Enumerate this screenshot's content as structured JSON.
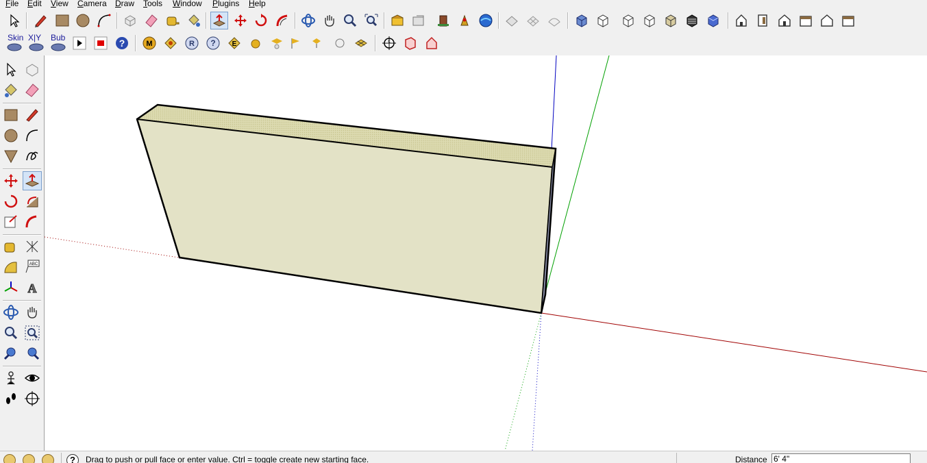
{
  "menu": [
    {
      "label": "File",
      "accel": "F"
    },
    {
      "label": "Edit",
      "accel": "E"
    },
    {
      "label": "View",
      "accel": "V"
    },
    {
      "label": "Camera",
      "accel": "C"
    },
    {
      "label": "Draw",
      "accel": "D"
    },
    {
      "label": "Tools",
      "accel": "T"
    },
    {
      "label": "Window",
      "accel": "W"
    },
    {
      "label": "Plugins",
      "accel": "P"
    },
    {
      "label": "Help",
      "accel": "H"
    }
  ],
  "plugins_toolbar": {
    "skin_label": "Skin",
    "xy_label": "X|Y",
    "bub_label": "Bub"
  },
  "status": {
    "message": "Drag to push or pull face or enter value.  Ctrl = toggle create new starting face.",
    "measurement_label": "Distance",
    "measurement_value": "6' 4\""
  },
  "colors": {
    "face": "#e3e2c6",
    "face_top": "#d7d5a8",
    "side": "#8a8ea8",
    "edge": "#000000",
    "axis_red": "#a00000",
    "axis_green": "#00a000",
    "axis_blue": "#0000c0",
    "selected_tool_bg": "#d4e4f7"
  }
}
